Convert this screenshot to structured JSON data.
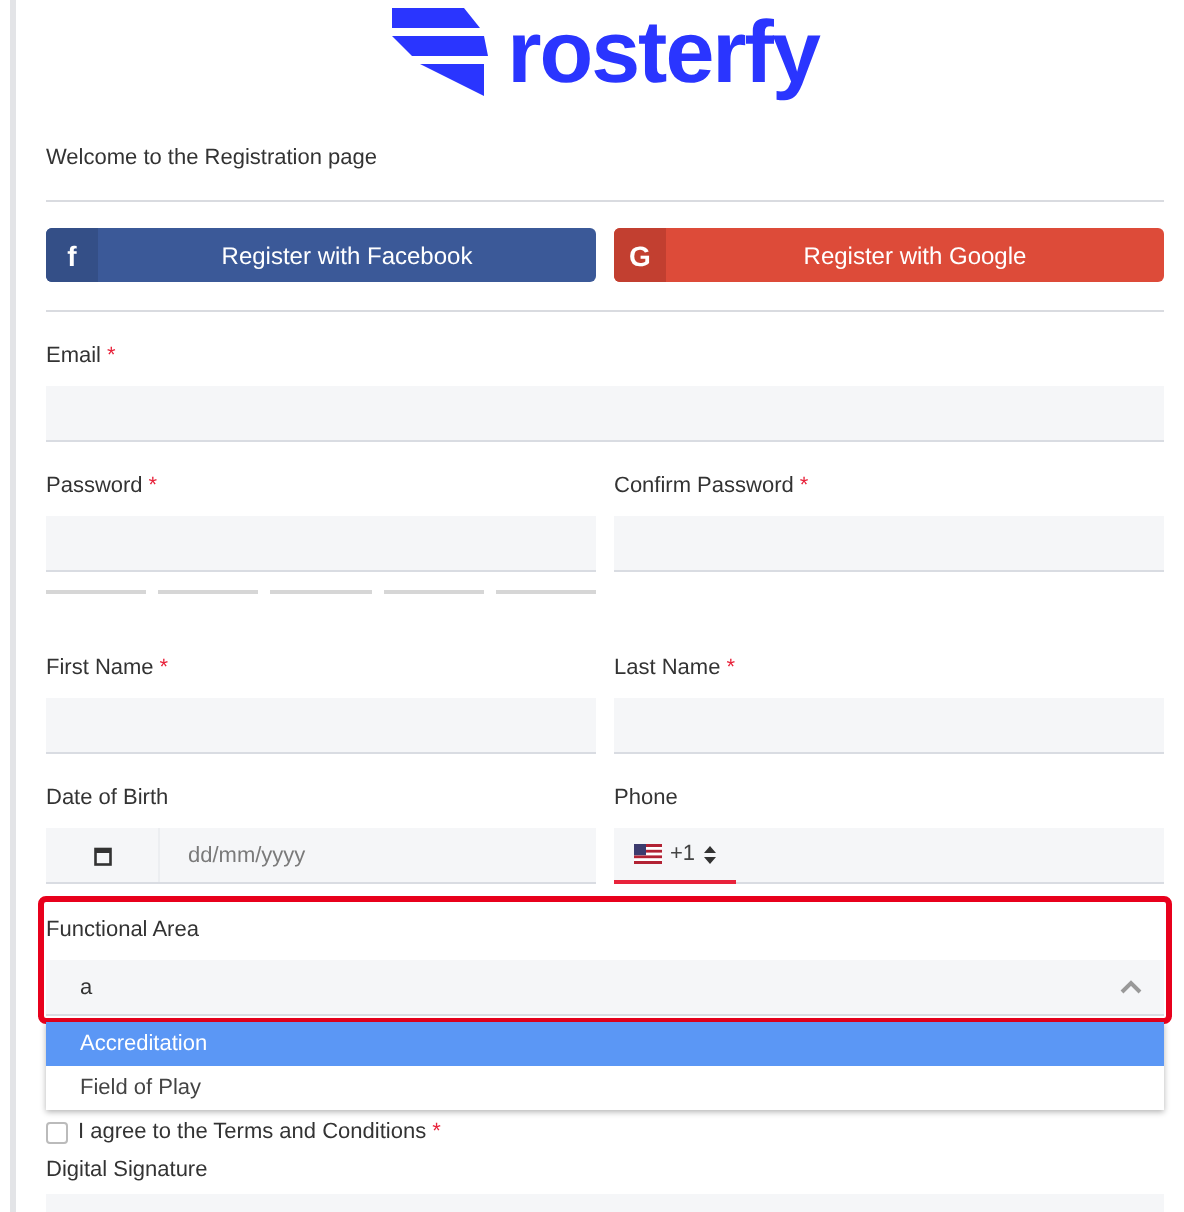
{
  "logo": {
    "text": "rosterfy"
  },
  "intro": "Welcome to the Registration page",
  "social_buttons": [
    {
      "kind": "facebook",
      "icon": "f",
      "label": "Register with Facebook"
    },
    {
      "kind": "google",
      "icon": "G",
      "label": "Register with Google"
    }
  ],
  "rows": [
    {
      "fields": [
        {
          "kind": "text",
          "label": "Email",
          "required_mark": "*"
        }
      ]
    },
    {
      "fields": [
        {
          "kind": "password",
          "label": "Password",
          "required_mark": "*"
        },
        {
          "kind": "text",
          "label": "Confirm Password",
          "required_mark": "*"
        }
      ]
    },
    {
      "fields": [
        {
          "kind": "text",
          "label": "First Name",
          "required_mark": "*"
        },
        {
          "kind": "text",
          "label": "Last Name",
          "required_mark": "*"
        }
      ]
    },
    {
      "fields": [
        {
          "kind": "date",
          "label": "Date of Birth",
          "placeholder": "dd/mm/yyyy"
        },
        {
          "kind": "phone",
          "label": "Phone",
          "dial_code": "+1"
        }
      ]
    },
    {
      "fields": [
        {
          "kind": "select",
          "label": "Functional Area",
          "value": "a",
          "highlighted": true,
          "expanded": true,
          "options": [
            {
              "label": "Accreditation",
              "selected": true
            },
            {
              "label": "Field of Play",
              "selected": false
            }
          ]
        }
      ]
    }
  ],
  "terms": {
    "label": "I agree to the Terms and Conditions",
    "required_mark": "*",
    "checked": false
  },
  "signature": {
    "label": "Digital Signature"
  }
}
